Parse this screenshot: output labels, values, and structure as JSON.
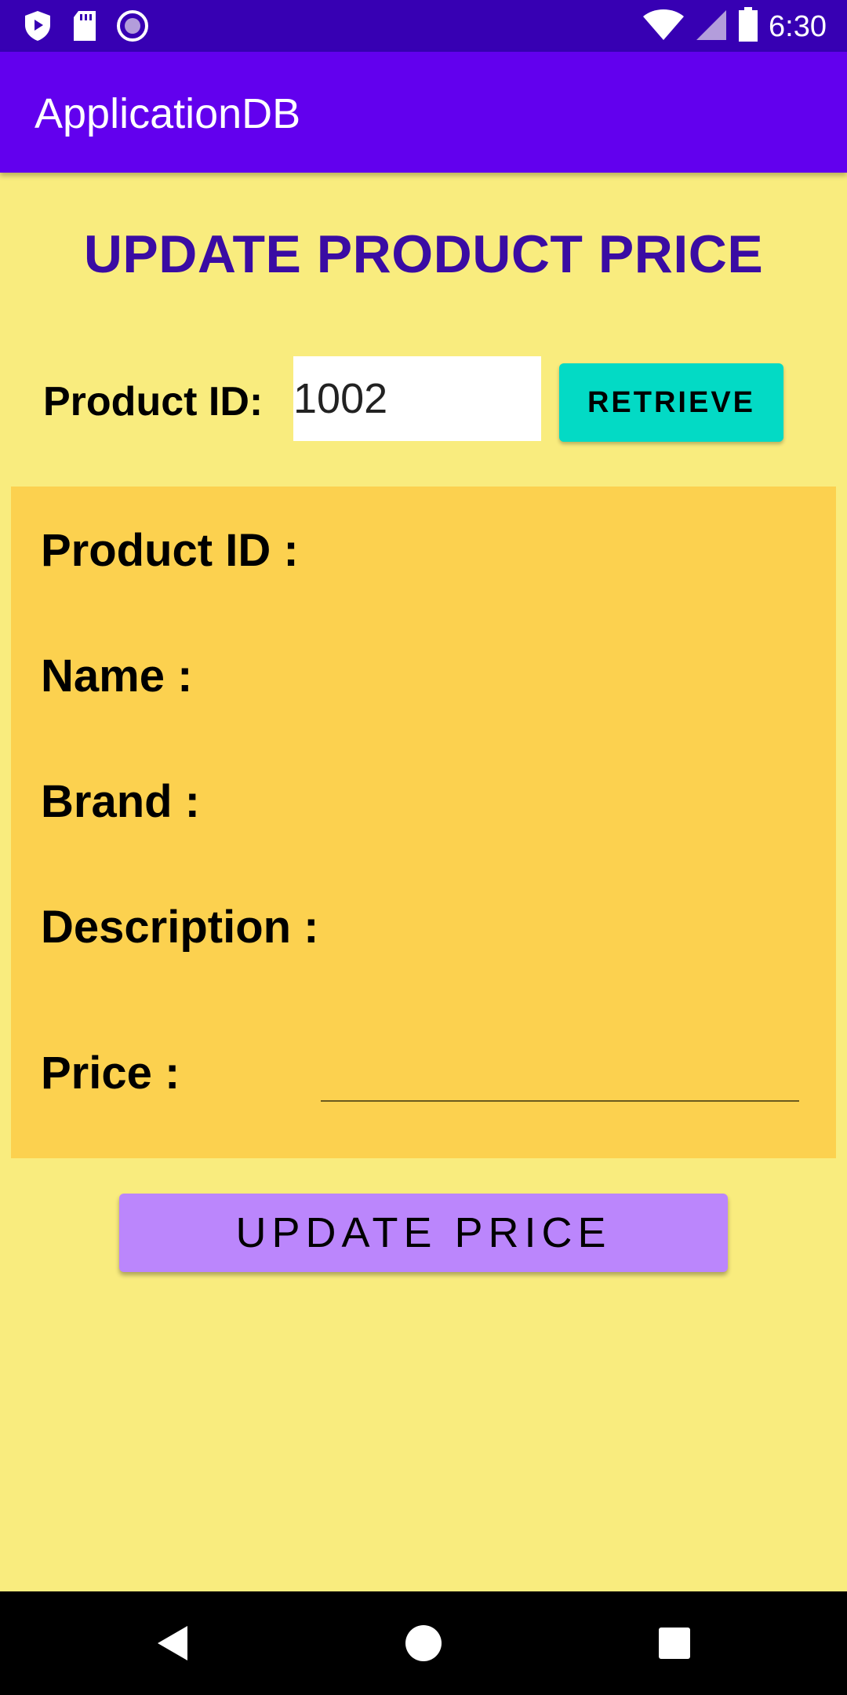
{
  "status_bar": {
    "time": "6:30",
    "left_icons": [
      "shield-play-icon",
      "sd-card-icon",
      "record-icon"
    ],
    "right_icons": [
      "wifi-icon",
      "cell-signal-icon",
      "battery-icon"
    ]
  },
  "app_bar": {
    "title": "ApplicationDB"
  },
  "page": {
    "heading": "UPDATE PRODUCT PRICE",
    "product_id_label": "Product ID:",
    "product_id_value": "1002",
    "retrieve_label": "RETRIEVE"
  },
  "details": {
    "product_id_label": "Product ID :",
    "name_label": "Name :",
    "brand_label": "Brand :",
    "description_label": "Description :",
    "price_label": "Price :",
    "price_value": ""
  },
  "actions": {
    "update_price_label": "UPDATE PRICE"
  },
  "nav_bar": {
    "buttons": [
      "back-icon",
      "home-icon",
      "recents-icon"
    ]
  },
  "colors": {
    "status_bar": "#3700b3",
    "app_bar": "#6200ee",
    "background": "#f9ec7e",
    "panel": "#fcd14f",
    "heading": "#3a0ca3",
    "retrieve_button": "#03dac5",
    "update_button": "#bb86fc"
  }
}
